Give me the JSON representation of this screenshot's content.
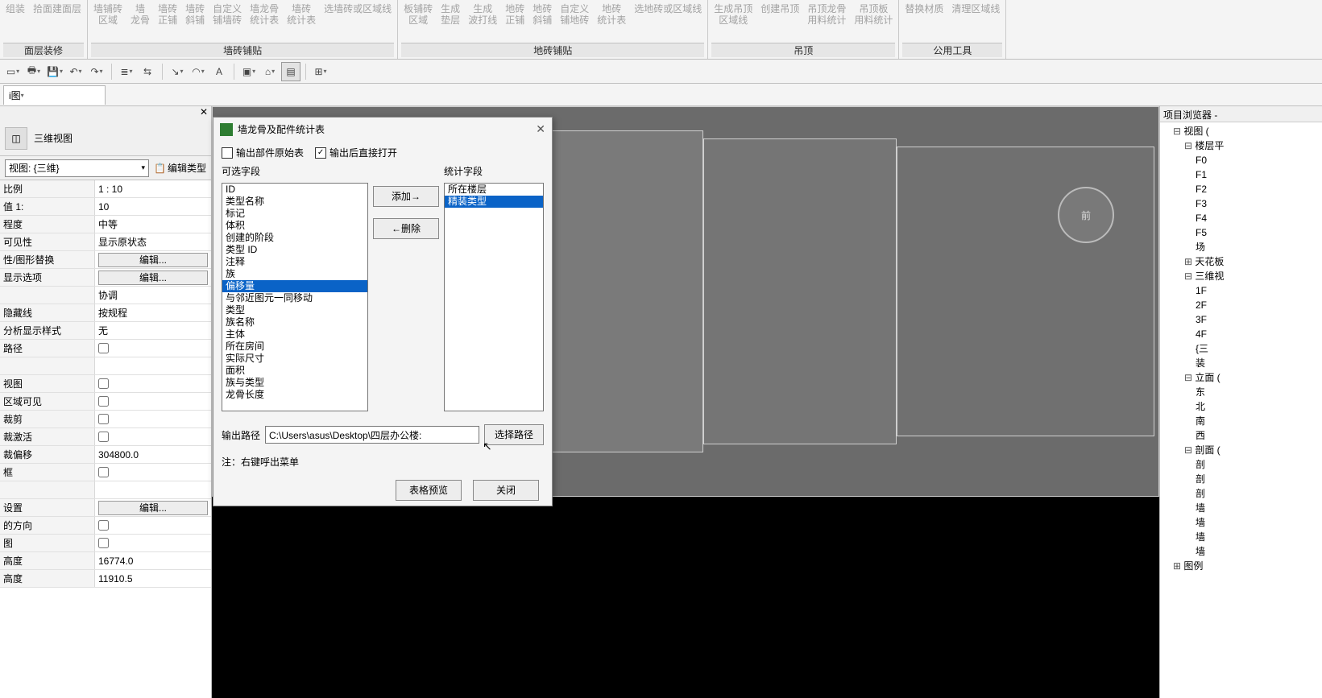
{
  "ribbon": {
    "groups": [
      {
        "label": "面层装修",
        "buttons": [
          "组装",
          "拾面建面层"
        ]
      },
      {
        "label": "墙砖铺贴",
        "buttons": [
          "墙铺砖\n区域",
          "墙\n龙骨",
          "墙砖\n正铺",
          "墙砖\n斜铺",
          "自定义\n铺墙砖",
          "墙龙骨\n统计表",
          "墙砖\n统计表",
          "选墙砖或区域线"
        ]
      },
      {
        "label": "地砖铺贴",
        "buttons": [
          "板铺砖\n区域",
          "生成\n垫层",
          "生成\n波打线",
          "地砖\n正铺",
          "地砖\n斜铺",
          "自定义\n铺地砖",
          "地砖\n统计表",
          "选地砖或区域线"
        ]
      },
      {
        "label": "吊顶",
        "buttons": [
          "生成吊顶\n区域线",
          "创建吊顶",
          "吊顶龙骨\n用料统计",
          "吊顶板\n用料统计"
        ]
      },
      {
        "label": "公用工具",
        "buttons": [
          "替换材质",
          "清理区域线"
        ]
      }
    ]
  },
  "qat_buttons": [
    "sel",
    "print",
    "save",
    "undo",
    "redo",
    "sync",
    "split",
    "split2",
    "line",
    "arc",
    "text",
    "cube",
    "filter",
    "mod",
    "expand"
  ],
  "view_tab": "i图",
  "panel": {
    "title": "三维视图",
    "subheader_left": "视图: {三维}",
    "subheader_right": "编辑类型",
    "rows": [
      {
        "k": "比例",
        "v": "1 : 10"
      },
      {
        "k": "值 1:",
        "v": "10"
      },
      {
        "k": "程度",
        "v": "中等"
      },
      {
        "k": "可见性",
        "v": "显示原状态"
      },
      {
        "k": "性/图形替换",
        "btn": "编辑..."
      },
      {
        "k": "显示选项",
        "btn": "编辑..."
      },
      {
        "k": "",
        "v": "协调"
      },
      {
        "k": "隐藏线",
        "v": "按规程"
      },
      {
        "k": "分析显示样式",
        "v": "无"
      },
      {
        "k": "路径",
        "chk": false
      },
      {
        "k": "",
        "v": ""
      },
      {
        "k": "视图",
        "chk": false
      },
      {
        "k": "区域可见",
        "chk": false
      },
      {
        "k": "裁剪",
        "chk": false
      },
      {
        "k": "裁激活",
        "chk": false
      },
      {
        "k": "裁偏移",
        "v": "304800.0"
      },
      {
        "k": "框",
        "chk": false
      },
      {
        "k": "",
        "v": ""
      },
      {
        "k": "设置",
        "btn": "编辑..."
      },
      {
        "k": "的方向",
        "chk": false
      },
      {
        "k": "图",
        "chk": false
      },
      {
        "k": "高度",
        "v": "16774.0"
      },
      {
        "k": "高度",
        "v": "11910.5"
      }
    ]
  },
  "browser": {
    "title": "项目浏览器 -",
    "tree": [
      {
        "t": "视图 (",
        "lvl": 0,
        "tw": "⊟"
      },
      {
        "t": "楼层平",
        "lvl": 1,
        "tw": "⊟"
      },
      {
        "t": "F0",
        "lvl": 2
      },
      {
        "t": "F1",
        "lvl": 2
      },
      {
        "t": "F2",
        "lvl": 2
      },
      {
        "t": "F3",
        "lvl": 2
      },
      {
        "t": "F4",
        "lvl": 2
      },
      {
        "t": "F5",
        "lvl": 2
      },
      {
        "t": "场",
        "lvl": 2
      },
      {
        "t": "天花板",
        "lvl": 1,
        "tw": "⊞"
      },
      {
        "t": "三维视",
        "lvl": 1,
        "tw": "⊟"
      },
      {
        "t": "1F",
        "lvl": 2
      },
      {
        "t": "2F",
        "lvl": 2
      },
      {
        "t": "3F",
        "lvl": 2
      },
      {
        "t": "4F",
        "lvl": 2
      },
      {
        "t": "{三",
        "lvl": 2
      },
      {
        "t": "装",
        "lvl": 2
      },
      {
        "t": "立面 (",
        "lvl": 1,
        "tw": "⊟"
      },
      {
        "t": "东",
        "lvl": 2
      },
      {
        "t": "北",
        "lvl": 2
      },
      {
        "t": "南",
        "lvl": 2
      },
      {
        "t": "西",
        "lvl": 2
      },
      {
        "t": "剖面 (",
        "lvl": 1,
        "tw": "⊟"
      },
      {
        "t": "剖",
        "lvl": 2
      },
      {
        "t": "剖",
        "lvl": 2
      },
      {
        "t": "剖",
        "lvl": 2
      },
      {
        "t": "墙",
        "lvl": 2
      },
      {
        "t": "墙",
        "lvl": 2
      },
      {
        "t": "墙",
        "lvl": 2
      },
      {
        "t": "墙",
        "lvl": 2
      },
      {
        "t": "图例",
        "lvl": 0,
        "tw": "⊞"
      }
    ]
  },
  "steering_face": "前",
  "dialog": {
    "title": "墙龙骨及配件统计表",
    "chk1": {
      "label": "输出部件原始表",
      "checked": false
    },
    "chk2": {
      "label": "输出后直接打开",
      "checked": true
    },
    "label_available": "可选字段",
    "label_selected": "统计字段",
    "available": [
      "ID",
      "类型名称",
      "标记",
      "体积",
      "创建的阶段",
      "类型 ID",
      "注释",
      "族",
      "偏移量",
      "与邻近图元一同移动",
      "类型",
      "族名称",
      "主体",
      "所在房间",
      "实际尺寸",
      "面积",
      "族与类型",
      "龙骨长度"
    ],
    "available_sel": 8,
    "selected": [
      "所在楼层",
      "精装类型"
    ],
    "selected_sel": 1,
    "btn_add": "添加→",
    "btn_remove": "←删除",
    "path_label": "输出路径",
    "path_value": "C:\\Users\\asus\\Desktop\\四层办公楼:",
    "path_btn": "选择路径",
    "note": "注：右键呼出菜单",
    "btn_preview": "表格预览",
    "btn_close": "关闭"
  }
}
